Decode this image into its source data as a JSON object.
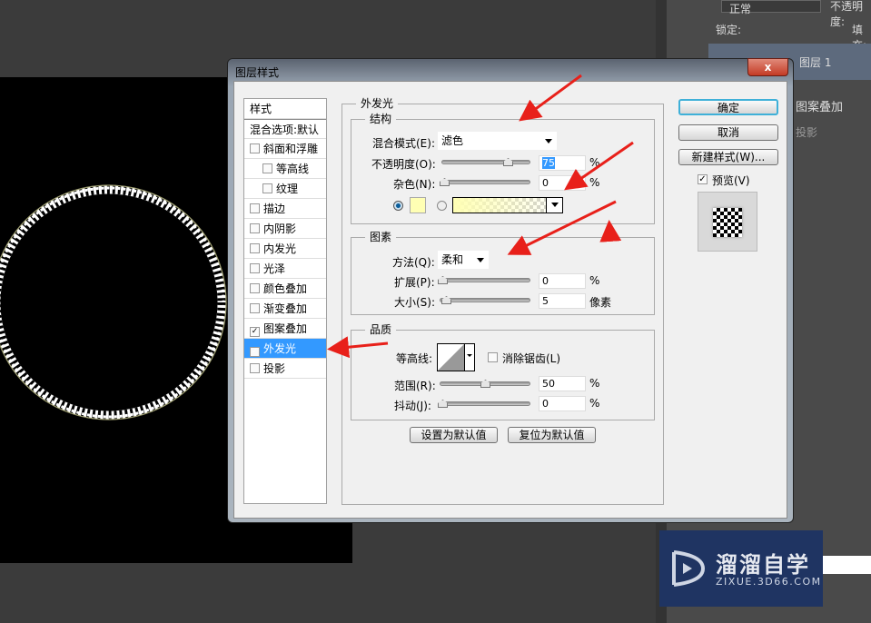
{
  "photoshop_panel": {
    "blend_mode": "正常",
    "opacity_label": "不透明度:",
    "lock_label": "锁定:",
    "fill_label": "填充:",
    "layer_name": "图层 1",
    "effect_pattern": "图案叠加",
    "effect_shadow": "投影"
  },
  "dialog": {
    "title": "图层样式",
    "close_label": "x"
  },
  "styles_list": {
    "header": "样式",
    "blend_options": "混合选项:默认",
    "items": [
      {
        "label": "斜面和浮雕",
        "checked": false,
        "indent": false
      },
      {
        "label": "等高线",
        "checked": false,
        "indent": true
      },
      {
        "label": "纹理",
        "checked": false,
        "indent": true
      },
      {
        "label": "描边",
        "checked": false,
        "indent": false
      },
      {
        "label": "内阴影",
        "checked": false,
        "indent": false
      },
      {
        "label": "内发光",
        "checked": false,
        "indent": false
      },
      {
        "label": "光泽",
        "checked": false,
        "indent": false
      },
      {
        "label": "颜色叠加",
        "checked": false,
        "indent": false
      },
      {
        "label": "渐变叠加",
        "checked": false,
        "indent": false
      },
      {
        "label": "图案叠加",
        "checked": true,
        "indent": false
      },
      {
        "label": "外发光",
        "checked": true,
        "indent": false,
        "selected": true
      },
      {
        "label": "投影",
        "checked": false,
        "indent": false
      }
    ]
  },
  "outer_glow": {
    "title": "外发光",
    "structure": {
      "title": "结构",
      "blend_mode_label": "混合模式(E):",
      "blend_mode": "滤色",
      "opacity_label": "不透明度(O):",
      "opacity": "75",
      "noise_label": "杂色(N):",
      "noise": "0",
      "unit": "%",
      "glow_color": "#ffffb4",
      "color_mode": "solid"
    },
    "elements": {
      "title": "图素",
      "technique_label": "方法(Q):",
      "technique": "柔和",
      "spread_label": "扩展(P):",
      "spread": "0",
      "size_label": "大小(S):",
      "size": "5",
      "percent": "%",
      "pixels": "像素"
    },
    "quality": {
      "title": "品质",
      "contour_label": "等高线:",
      "anti_alias_label": "消除锯齿(L)",
      "anti_alias": false,
      "range_label": "范围(R):",
      "range": "50",
      "jitter_label": "抖动(J):",
      "jitter": "0",
      "unit": "%"
    },
    "make_default": "设置为默认值",
    "reset_default": "复位为默认值"
  },
  "buttons": {
    "ok": "确定",
    "cancel": "取消",
    "new_style": "新建样式(W)...",
    "preview_label": "预览(V)",
    "preview": true
  },
  "watermark": {
    "name": "溜溜自学",
    "url": "ZIXUE.3D66.COM"
  },
  "colors": {
    "arrow": "#e8201a",
    "selection": "#3399ff"
  }
}
